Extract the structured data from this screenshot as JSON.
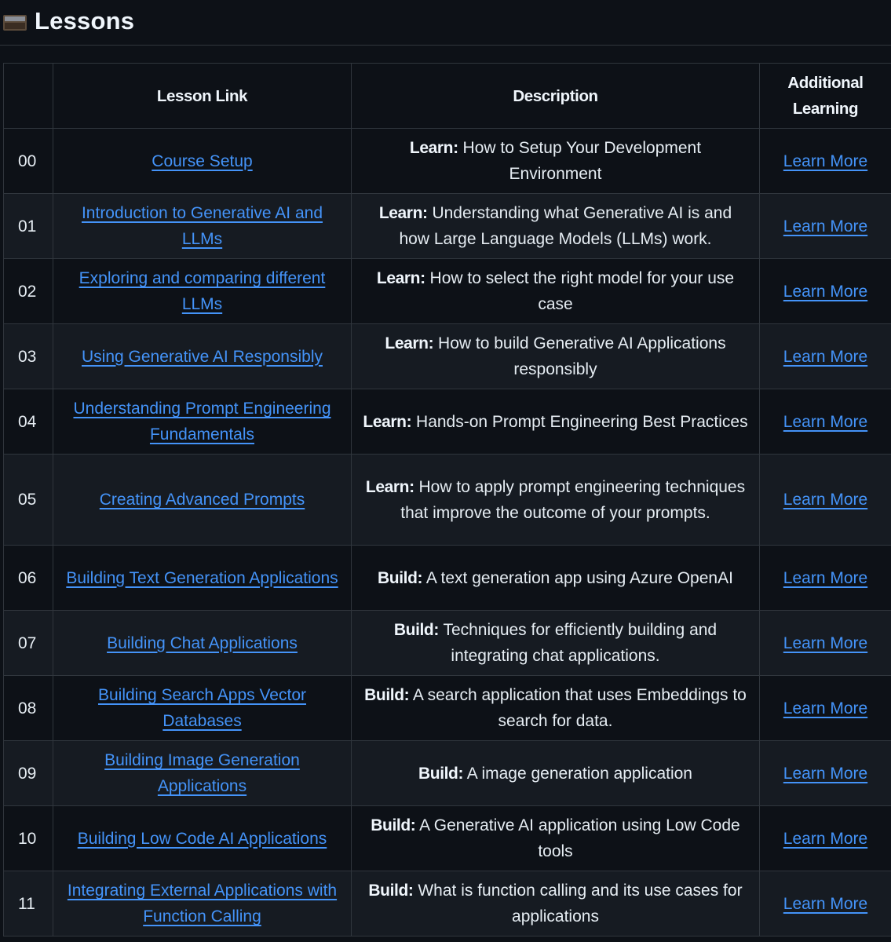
{
  "heading": {
    "icon": "card-file-box-icon",
    "title": "Lessons"
  },
  "table": {
    "headers": {
      "number": "",
      "lesson_link": "Lesson Link",
      "description": "Description",
      "additional": "Additional Learning"
    },
    "rows": [
      {
        "number": "00",
        "lesson": "Course Setup",
        "label": "Learn:",
        "text": "How to Setup Your Development Environment",
        "more": "Learn More"
      },
      {
        "number": "01",
        "lesson": "Introduction to Generative AI and LLMs",
        "label": "Learn:",
        "text": "Understanding what Generative AI is and how Large Language Models (LLMs) work.",
        "more": "Learn More"
      },
      {
        "number": "02",
        "lesson": "Exploring and comparing different LLMs",
        "label": "Learn:",
        "text": "How to select the right model for your use case",
        "more": "Learn More"
      },
      {
        "number": "03",
        "lesson": "Using Generative AI Responsibly",
        "label": "Learn:",
        "text": "How to build Generative AI Applications responsibly",
        "more": "Learn More"
      },
      {
        "number": "04",
        "lesson": "Understanding Prompt Engineering Fundamentals",
        "label": "Learn:",
        "text": "Hands-on Prompt Engineering Best Practices",
        "more": "Learn More"
      },
      {
        "number": "05",
        "lesson": "Creating Advanced Prompts",
        "label": "Learn:",
        "text": "How to apply prompt engineering techniques that improve the outcome of your prompts.",
        "more": "Learn More"
      },
      {
        "number": "06",
        "lesson": "Building Text Generation Applications",
        "label": "Build:",
        "text": "A text generation app using Azure OpenAI",
        "more": "Learn More"
      },
      {
        "number": "07",
        "lesson": "Building Chat Applications",
        "label": "Build:",
        "text": "Techniques for efficiently building and integrating chat applications.",
        "more": "Learn More"
      },
      {
        "number": "08",
        "lesson": "Building Search Apps Vector Databases",
        "label": "Build:",
        "text": "A search application that uses Embeddings to search for data.",
        "more": "Learn More"
      },
      {
        "number": "09",
        "lesson": "Building Image Generation Applications",
        "label": "Build:",
        "text": "A image generation application",
        "more": "Learn More"
      },
      {
        "number": "10",
        "lesson": "Building Low Code AI Applications",
        "label": "Build:",
        "text": "A Generative AI application using Low Code tools",
        "more": "Learn More"
      },
      {
        "number": "11",
        "lesson": "Integrating External Applications with Function Calling",
        "label": "Build:",
        "text": "What is function calling and its use cases for applications",
        "more": "Learn More"
      }
    ]
  }
}
